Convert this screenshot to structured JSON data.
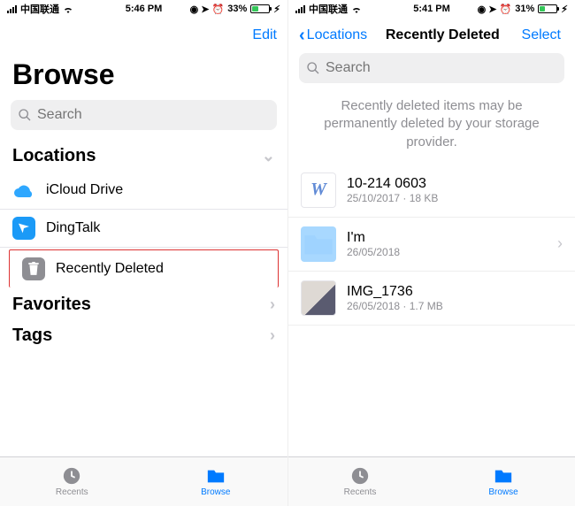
{
  "left": {
    "status": {
      "carrier": "中国联通",
      "time": "5:46 PM",
      "battery_pct": "33%",
      "battery_fill": 33
    },
    "nav": {
      "edit": "Edit"
    },
    "title": "Browse",
    "search_placeholder": "Search",
    "sections": {
      "locations": {
        "header": "Locations",
        "items": [
          {
            "label": "iCloud Drive"
          },
          {
            "label": "DingTalk"
          },
          {
            "label": "Recently Deleted"
          }
        ]
      },
      "favorites": {
        "header": "Favorites"
      },
      "tags": {
        "header": "Tags"
      }
    },
    "tabs": {
      "recents": "Recents",
      "browse": "Browse"
    }
  },
  "right": {
    "status": {
      "carrier": "中国联通",
      "time": "5:41 PM",
      "battery_pct": "31%",
      "battery_fill": 31
    },
    "nav": {
      "back": "Locations",
      "title": "Recently Deleted",
      "select": "Select"
    },
    "search_placeholder": "Search",
    "info": "Recently deleted items may be permanently deleted by your storage provider.",
    "files": [
      {
        "name": "10-214  0603",
        "sub": "25/10/2017 · 18 KB",
        "thumb": "doc"
      },
      {
        "name": "I'm",
        "sub": "26/05/2018",
        "thumb": "folder",
        "chevron": true
      },
      {
        "name": "IMG_1736",
        "sub": "26/05/2018 · 1.7 MB",
        "thumb": "image"
      }
    ],
    "tabs": {
      "recents": "Recents",
      "browse": "Browse"
    }
  }
}
